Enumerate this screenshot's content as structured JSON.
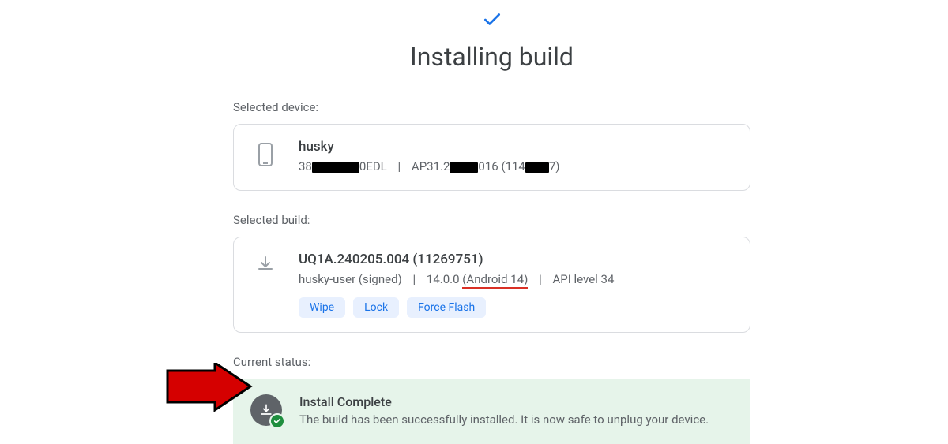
{
  "header": {
    "title": "Installing build"
  },
  "device": {
    "section_label": "Selected device:",
    "name": "husky",
    "serial_prefix": "38",
    "serial_suffix": "0EDL",
    "build_prefix": "AP31.2",
    "build_mid": "016",
    "build_paren_prefix": "(114",
    "build_paren_suffix": "7)"
  },
  "build": {
    "section_label": "Selected build:",
    "id": "UQ1A.240205.004 (11269751)",
    "variant": "husky-user (signed)",
    "version": "14.0.0",
    "android_label": "(Android 14)",
    "api_label": "API level 34",
    "chips": {
      "wipe": "Wipe",
      "lock": "Lock",
      "force_flash": "Force Flash"
    }
  },
  "status": {
    "section_label": "Current status:",
    "title": "Install Complete",
    "message": "The build has been successfully installed. It is now safe to unplug your device."
  }
}
